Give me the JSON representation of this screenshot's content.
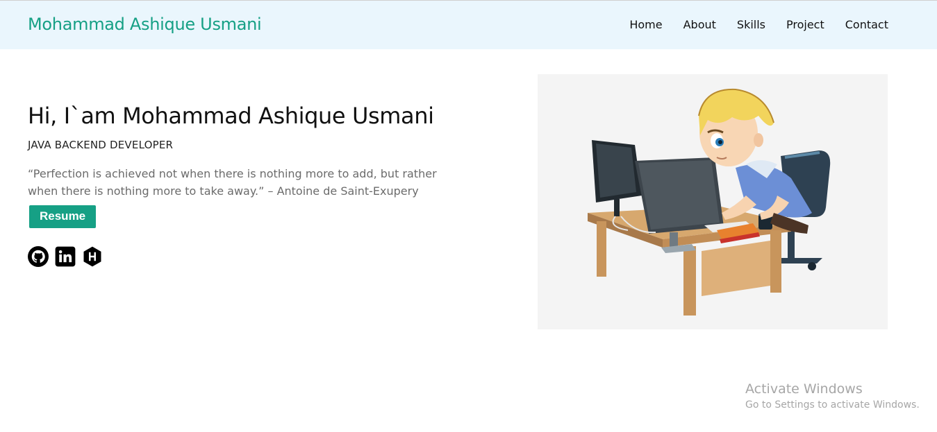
{
  "header": {
    "brand": "Mohammad Ashique Usmani",
    "nav": [
      {
        "label": "Home"
      },
      {
        "label": "About"
      },
      {
        "label": "Skills"
      },
      {
        "label": "Project"
      },
      {
        "label": "Contact"
      }
    ]
  },
  "hero": {
    "title": "Hi, I`am Mohammad Ashique Usmani",
    "role": "JAVA BACKEND DEVELOPER",
    "quote": "“Perfection is achieved not when there is nothing more to add, but rather when there is nothing more to take away.” – Antoine de Saint-Exupery",
    "resume_label": "Resume",
    "socials": [
      {
        "icon": "github-icon"
      },
      {
        "icon": "linkedin-icon"
      },
      {
        "icon": "hashnode-icon"
      }
    ],
    "image": {
      "icon": "developer-illustration"
    }
  },
  "watermark": {
    "title": "Activate Windows",
    "subtitle": "Go to Settings to activate Windows."
  },
  "colors": {
    "accent": "#16a085",
    "navbar_bg": "#eaf6fd",
    "image_bg": "#f4f4f4"
  }
}
